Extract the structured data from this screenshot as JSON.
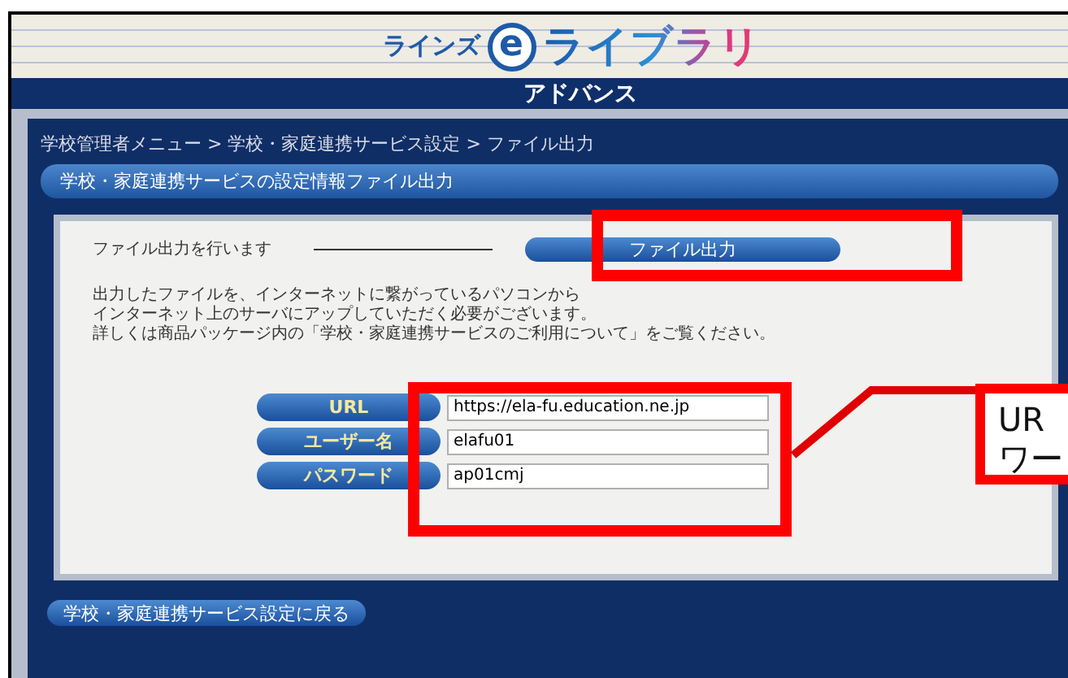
{
  "logo": {
    "brand": "ラインズ",
    "mark": "e",
    "product": "ライブラリ",
    "edition": "アドバンス"
  },
  "breadcrumb": "学校管理者メニュー > 学校・家庭連携サービス設定 > ファイル出力",
  "section_title": "学校・家庭連携サービスの設定情報ファイル出力",
  "export": {
    "label": "ファイル出力を行います",
    "button": "ファイル出力"
  },
  "description": [
    "出力したファイルを、インターネットに繋がっているパソコンから",
    "インターネット上のサーバにアップしていただく必要がございます。",
    "詳しくは商品パッケージ内の「学校・家庭連携サービスのご利用について」をご覧ください。"
  ],
  "fields": [
    {
      "label": "URL",
      "value": "https://ela-fu.education.ne.jp"
    },
    {
      "label": "ユーザー名",
      "value": "elafu01"
    },
    {
      "label": "パスワード",
      "value": "ap01cmj"
    }
  ],
  "back_button": "学校・家庭連携サービス設定に戻る",
  "callout": {
    "lines": [
      "UR",
      "ワー"
    ]
  }
}
